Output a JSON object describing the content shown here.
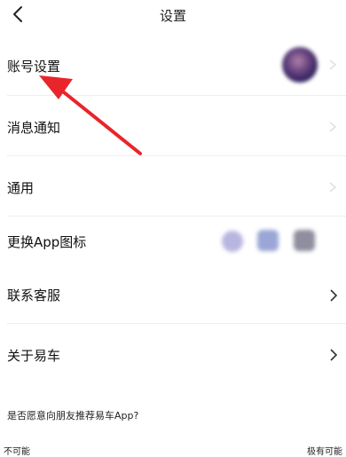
{
  "nav": {
    "title": "设置"
  },
  "rows": [
    {
      "label": "账号设置"
    },
    {
      "label": "消息通知"
    },
    {
      "label": "通用"
    },
    {
      "label": "更换App图标"
    },
    {
      "label": "联系客服"
    },
    {
      "label": "关于易车"
    }
  ],
  "recommend": {
    "question": "是否愿意向朋友推荐易车App?",
    "low_label": "不可能",
    "high_label": "极有可能"
  },
  "annotation": {
    "arrow_color": "#e8252a"
  }
}
